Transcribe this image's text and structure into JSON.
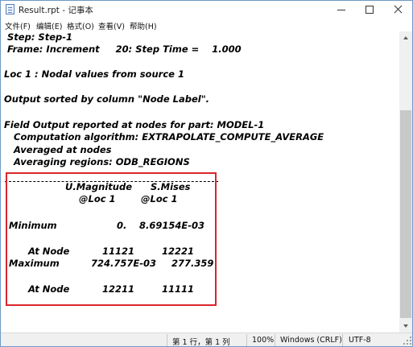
{
  "window": {
    "title": "Result.rpt - 记事本"
  },
  "menu": {
    "items": [
      "文件(F)",
      "编辑(E)",
      "格式(O)",
      "查看(V)",
      "帮助(H)"
    ]
  },
  "editor": {
    "lines": [
      " Step: Step-1",
      " Frame: Increment     20: Step Time =    1.000",
      "Loc 1 : Nodal values from source 1",
      "Output sorted by column \"Node Label\".",
      "Field Output reported at nodes for part: MODEL-1",
      "   Computation algorithm: EXTRAPOLATE_COMPUTE_AVERAGE",
      "   Averaged at nodes",
      "   Averaging regions: ODB_REGIONS",
      "U.Magnitude",
      "S.Mises",
      "@Loc 1",
      "@Loc 1",
      "Minimum",
      "0.",
      "8.69154E-03",
      "At Node",
      "11121",
      "12221",
      "Maximum",
      "724.757E-03",
      "277.359",
      "At Node",
      "12211",
      "11111"
    ]
  },
  "status": {
    "position": "第 1 行，第 1 列",
    "zoom": "100%",
    "line_ending": "Windows (CRLF)",
    "encoding": "UTF-8"
  },
  "colors": {
    "highlight_box": "#d9252b"
  }
}
